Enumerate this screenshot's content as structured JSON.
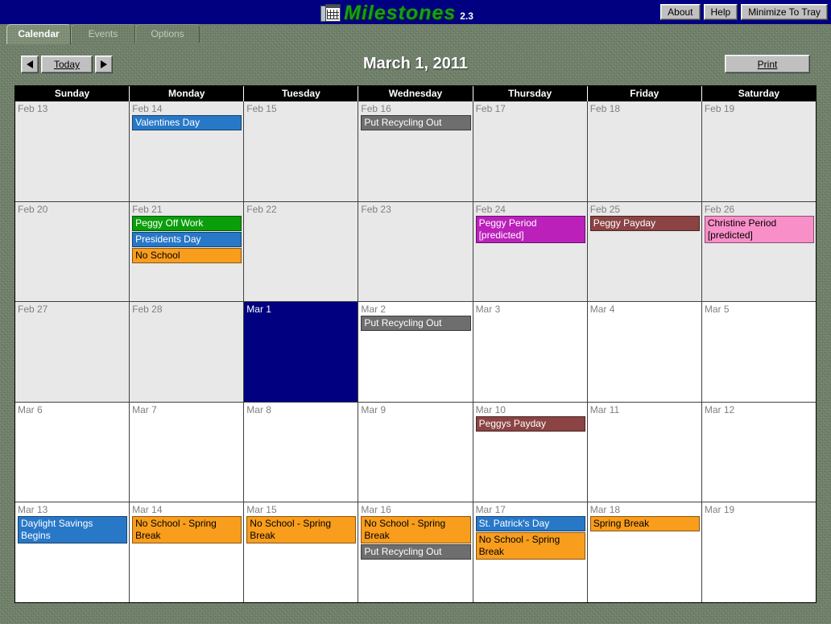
{
  "titlebar": {
    "logo_text": "Milestones",
    "version": "2.3",
    "logo_icon": "calendar-icon",
    "buttons": [
      {
        "label": "About",
        "name": "about-button"
      },
      {
        "label": "Help",
        "name": "help-button"
      },
      {
        "label": "Minimize To Tray",
        "name": "minimize-to-tray-button"
      }
    ]
  },
  "tabs": [
    {
      "label": "Calendar",
      "active": true
    },
    {
      "label": "Events",
      "active": false
    },
    {
      "label": "Options",
      "active": false
    }
  ],
  "toolbar": {
    "prev_label": "◀",
    "today_label": "Today",
    "next_label": "▶",
    "month_title": "March 1, 2011",
    "print_label": "Print"
  },
  "calendar": {
    "day_headers": [
      "Sunday",
      "Monday",
      "Tuesday",
      "Wednesday",
      "Thursday",
      "Friday",
      "Saturday"
    ],
    "colors": {
      "selected_day": "#000080",
      "past_day": "#e8e8e8",
      "future_day": "#ffffff",
      "blue_event": "#2878c8",
      "green_event": "#0a9e0a",
      "orange_event": "#f99d1c",
      "grey_event": "#6e6e6e",
      "magenta_event": "#bb20bb",
      "maroon_event": "#8b4343",
      "pink_event": "#f98fc8"
    },
    "weeks": [
      [
        {
          "date": "Feb 13",
          "state": "past",
          "events": []
        },
        {
          "date": "Feb 14",
          "state": "past",
          "events": [
            {
              "label": "Valentines Day",
              "bg": "#2878c8",
              "fg": "#ffffff"
            }
          ]
        },
        {
          "date": "Feb 15",
          "state": "past",
          "events": []
        },
        {
          "date": "Feb 16",
          "state": "past",
          "events": [
            {
              "label": "Put Recycling Out",
              "bg": "#6e6e6e",
              "fg": "#ffffff"
            }
          ]
        },
        {
          "date": "Feb 17",
          "state": "past",
          "events": []
        },
        {
          "date": "Feb 18",
          "state": "past",
          "events": []
        },
        {
          "date": "Feb 19",
          "state": "past",
          "events": []
        }
      ],
      [
        {
          "date": "Feb 20",
          "state": "past",
          "events": []
        },
        {
          "date": "Feb 21",
          "state": "past",
          "events": [
            {
              "label": "Peggy Off Work",
              "bg": "#0a9e0a",
              "fg": "#ffffff"
            },
            {
              "label": "Presidents Day",
              "bg": "#2878c8",
              "fg": "#ffffff"
            },
            {
              "label": "No School",
              "bg": "#f99d1c",
              "fg": "#000000"
            }
          ]
        },
        {
          "date": "Feb 22",
          "state": "past",
          "events": []
        },
        {
          "date": "Feb 23",
          "state": "past",
          "events": []
        },
        {
          "date": "Feb 24",
          "state": "past",
          "events": [
            {
              "label": "Peggy Period\n[predicted]",
              "bg": "#bb20bb",
              "fg": "#ffffff"
            }
          ]
        },
        {
          "date": "Feb 25",
          "state": "past",
          "events": [
            {
              "label": "Peggy Payday",
              "bg": "#8b4343",
              "fg": "#ffffff"
            }
          ]
        },
        {
          "date": "Feb 26",
          "state": "past",
          "events": [
            {
              "label": "Christine Period\n[predicted]",
              "bg": "#f98fc8",
              "fg": "#000000"
            }
          ]
        }
      ],
      [
        {
          "date": "Feb 27",
          "state": "past",
          "events": []
        },
        {
          "date": "Feb 28",
          "state": "past",
          "events": []
        },
        {
          "date": "Mar 1",
          "state": "selected",
          "events": []
        },
        {
          "date": "Mar 2",
          "state": "future",
          "events": [
            {
              "label": "Put Recycling Out",
              "bg": "#6e6e6e",
              "fg": "#ffffff"
            }
          ]
        },
        {
          "date": "Mar 3",
          "state": "future",
          "events": []
        },
        {
          "date": "Mar 4",
          "state": "future",
          "events": []
        },
        {
          "date": "Mar 5",
          "state": "future",
          "events": []
        }
      ],
      [
        {
          "date": "Mar 6",
          "state": "future",
          "events": []
        },
        {
          "date": "Mar 7",
          "state": "future",
          "events": []
        },
        {
          "date": "Mar 8",
          "state": "future",
          "events": []
        },
        {
          "date": "Mar 9",
          "state": "future",
          "events": []
        },
        {
          "date": "Mar 10",
          "state": "future",
          "events": [
            {
              "label": "Peggys Payday",
              "bg": "#8b4343",
              "fg": "#ffffff"
            }
          ]
        },
        {
          "date": "Mar 11",
          "state": "future",
          "events": []
        },
        {
          "date": "Mar 12",
          "state": "future",
          "events": []
        }
      ],
      [
        {
          "date": "Mar 13",
          "state": "future",
          "events": [
            {
              "label": "Daylight Savings Begins",
              "bg": "#2878c8",
              "fg": "#ffffff"
            }
          ]
        },
        {
          "date": "Mar 14",
          "state": "future",
          "events": [
            {
              "label": "No School - Spring Break",
              "bg": "#f99d1c",
              "fg": "#000000"
            }
          ]
        },
        {
          "date": "Mar 15",
          "state": "future",
          "events": [
            {
              "label": "No School - Spring Break",
              "bg": "#f99d1c",
              "fg": "#000000"
            }
          ]
        },
        {
          "date": "Mar 16",
          "state": "future",
          "events": [
            {
              "label": "No School - Spring Break",
              "bg": "#f99d1c",
              "fg": "#000000"
            },
            {
              "label": "Put Recycling Out",
              "bg": "#6e6e6e",
              "fg": "#ffffff"
            }
          ]
        },
        {
          "date": "Mar 17",
          "state": "future",
          "events": [
            {
              "label": "St. Patrick's Day",
              "bg": "#2878c8",
              "fg": "#ffffff"
            },
            {
              "label": "No School - Spring Break",
              "bg": "#f99d1c",
              "fg": "#000000"
            }
          ]
        },
        {
          "date": "Mar 18",
          "state": "future",
          "events": [
            {
              "label": "Spring Break",
              "bg": "#f99d1c",
              "fg": "#000000"
            }
          ]
        },
        {
          "date": "Mar 19",
          "state": "future",
          "events": []
        }
      ]
    ]
  }
}
